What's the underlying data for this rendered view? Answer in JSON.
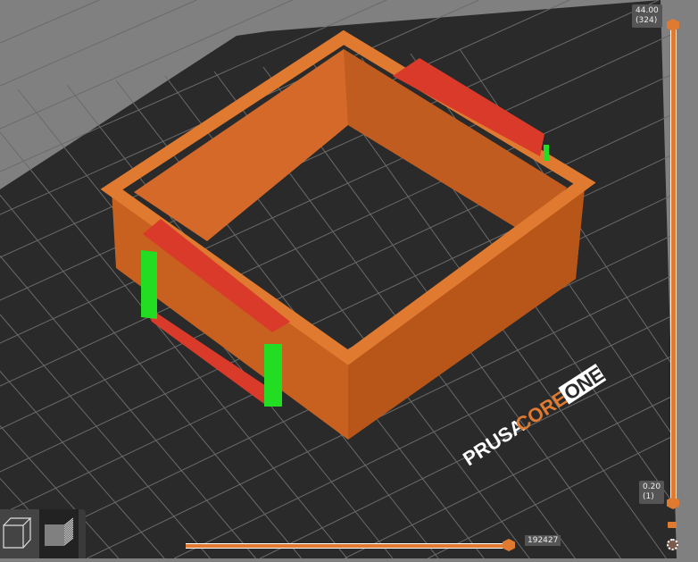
{
  "bed": {
    "logo": {
      "brand": "PRUSA",
      "model1": "CORE",
      "model2": "ONE"
    }
  },
  "vertical_slider": {
    "top": {
      "height": "44.00",
      "layer": "(324)"
    },
    "bottom": {
      "height": "0.20",
      "layer": "(1)"
    },
    "top_fraction": 1.0,
    "bottom_fraction": 0.0
  },
  "horizontal_slider": {
    "value": "192427",
    "fraction": 1.0
  },
  "view_buttons": [
    {
      "name": "3d-view"
    },
    {
      "name": "preview"
    }
  ],
  "colors": {
    "accent": "#e07a30",
    "wall": "#d4692a",
    "support": "#d93a2a",
    "green": "#22dd22"
  }
}
